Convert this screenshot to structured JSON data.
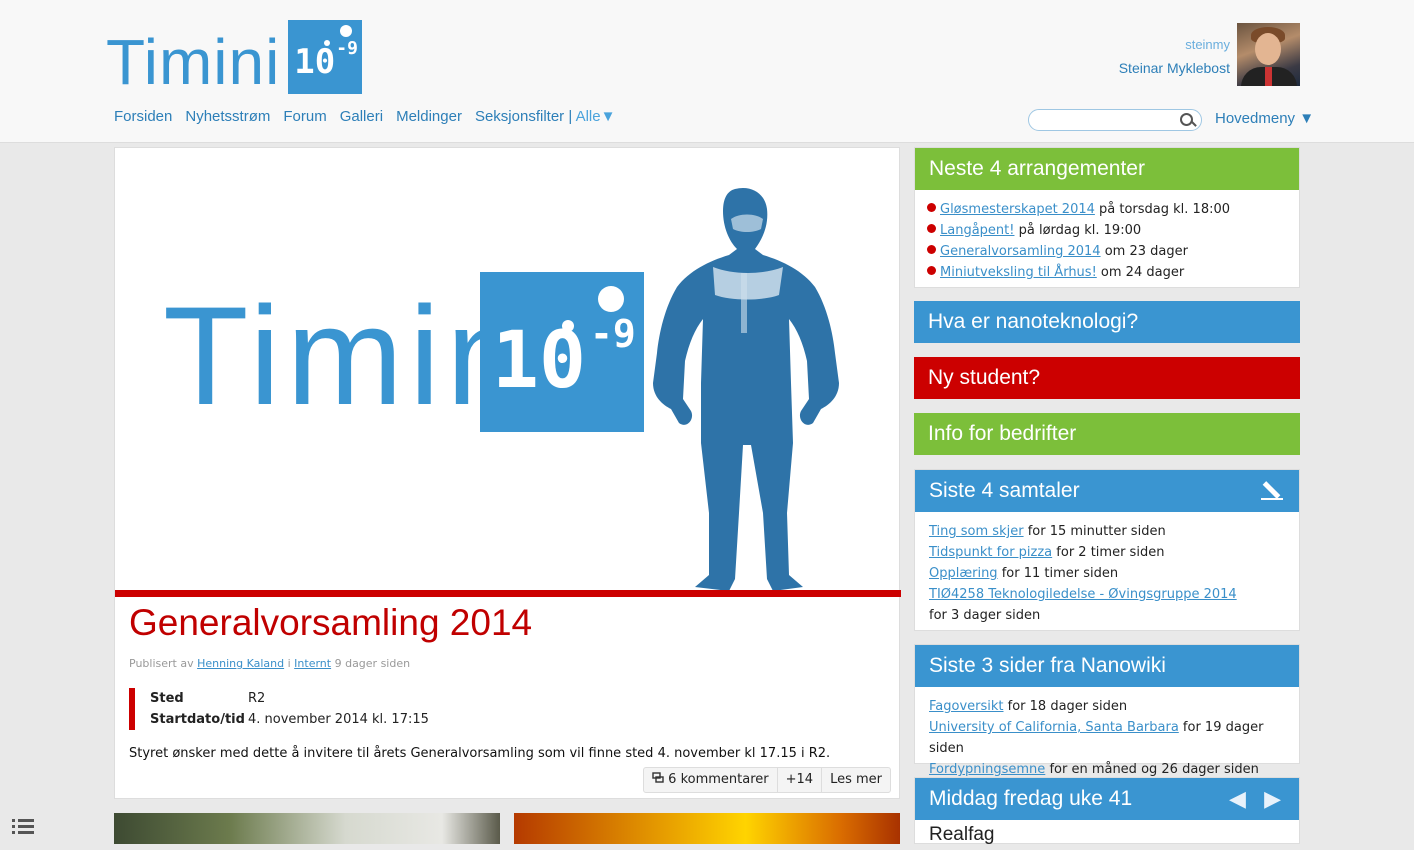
{
  "header": {
    "logo_word": "Timini",
    "logo_num": "10",
    "logo_exp": "-9",
    "nav": [
      "Forsiden",
      "Nyhetsstrøm",
      "Forum",
      "Galleri",
      "Meldinger",
      "Seksjonsfilter |"
    ],
    "filter_value": "Alle",
    "filter_arrow": "▼",
    "user": {
      "username": "steinmy",
      "full_name": "Steinar Myklebost"
    },
    "search": {
      "value": "",
      "placeholder": ""
    },
    "main_menu": "Hovedmeny ▼"
  },
  "article": {
    "hero_word": "Timini",
    "hero_num": "10",
    "hero_exp": "-9",
    "title": "Generalvorsamling 2014",
    "meta": {
      "prefix": "Publisert av",
      "author": "Henning Kaland",
      "in": "i",
      "category": "Internt",
      "ago": "9 dager siden"
    },
    "info": [
      {
        "key": "Sted",
        "value": "R2"
      },
      {
        "key": "Startdato/tid",
        "value": "4. november 2014 kl. 17:15"
      }
    ],
    "body": "Styret ønsker med dette å invitere til årets Generalvorsamling som vil finne sted 4. november kl 17.15 i R2.",
    "comments": "6 kommentarer",
    "plus": "+14",
    "read_more": "Les mer"
  },
  "sidebar": {
    "events": {
      "title": "Neste 4 arrangementer",
      "items": [
        {
          "link": "Gløsmesterskapet 2014",
          "when": "på torsdag kl. 18:00"
        },
        {
          "link": "Langåpent!",
          "when": "på lørdag kl. 19:00"
        },
        {
          "link": "Generalvorsamling 2014",
          "when": "om 23 dager"
        },
        {
          "link": "Miniutveksling til Århus!",
          "when": "om 24 dager"
        }
      ]
    },
    "nano": "Hva er nanoteknologi?",
    "new_student": "Ny student?",
    "companies": "Info for bedrifter",
    "talks": {
      "title": "Siste 4 samtaler",
      "items": [
        {
          "link": "Ting som skjer",
          "when": "for 15 minutter siden"
        },
        {
          "link": "Tidspunkt for pizza",
          "when": "for 2 timer siden"
        },
        {
          "link": "Opplæring",
          "when": "for 11 timer siden"
        },
        {
          "link": "TIØ4258 Teknologiledelse - Øvingsgruppe 2014",
          "when": "for 3 dager siden"
        }
      ]
    },
    "wiki": {
      "title": "Siste 3 sider fra Nanowiki",
      "items": [
        {
          "link": "Fagoversikt",
          "when": "for 18 dager siden"
        },
        {
          "link": "University of California, Santa Barbara",
          "when": "for 19 dager siden"
        },
        {
          "link": "Fordypningsemne",
          "when": "for en måned og 26 dager siden"
        }
      ]
    },
    "dinner": {
      "title": "Middag fredag uke 41",
      "arrows": "◀ ▶",
      "first": "Realfag"
    }
  }
}
